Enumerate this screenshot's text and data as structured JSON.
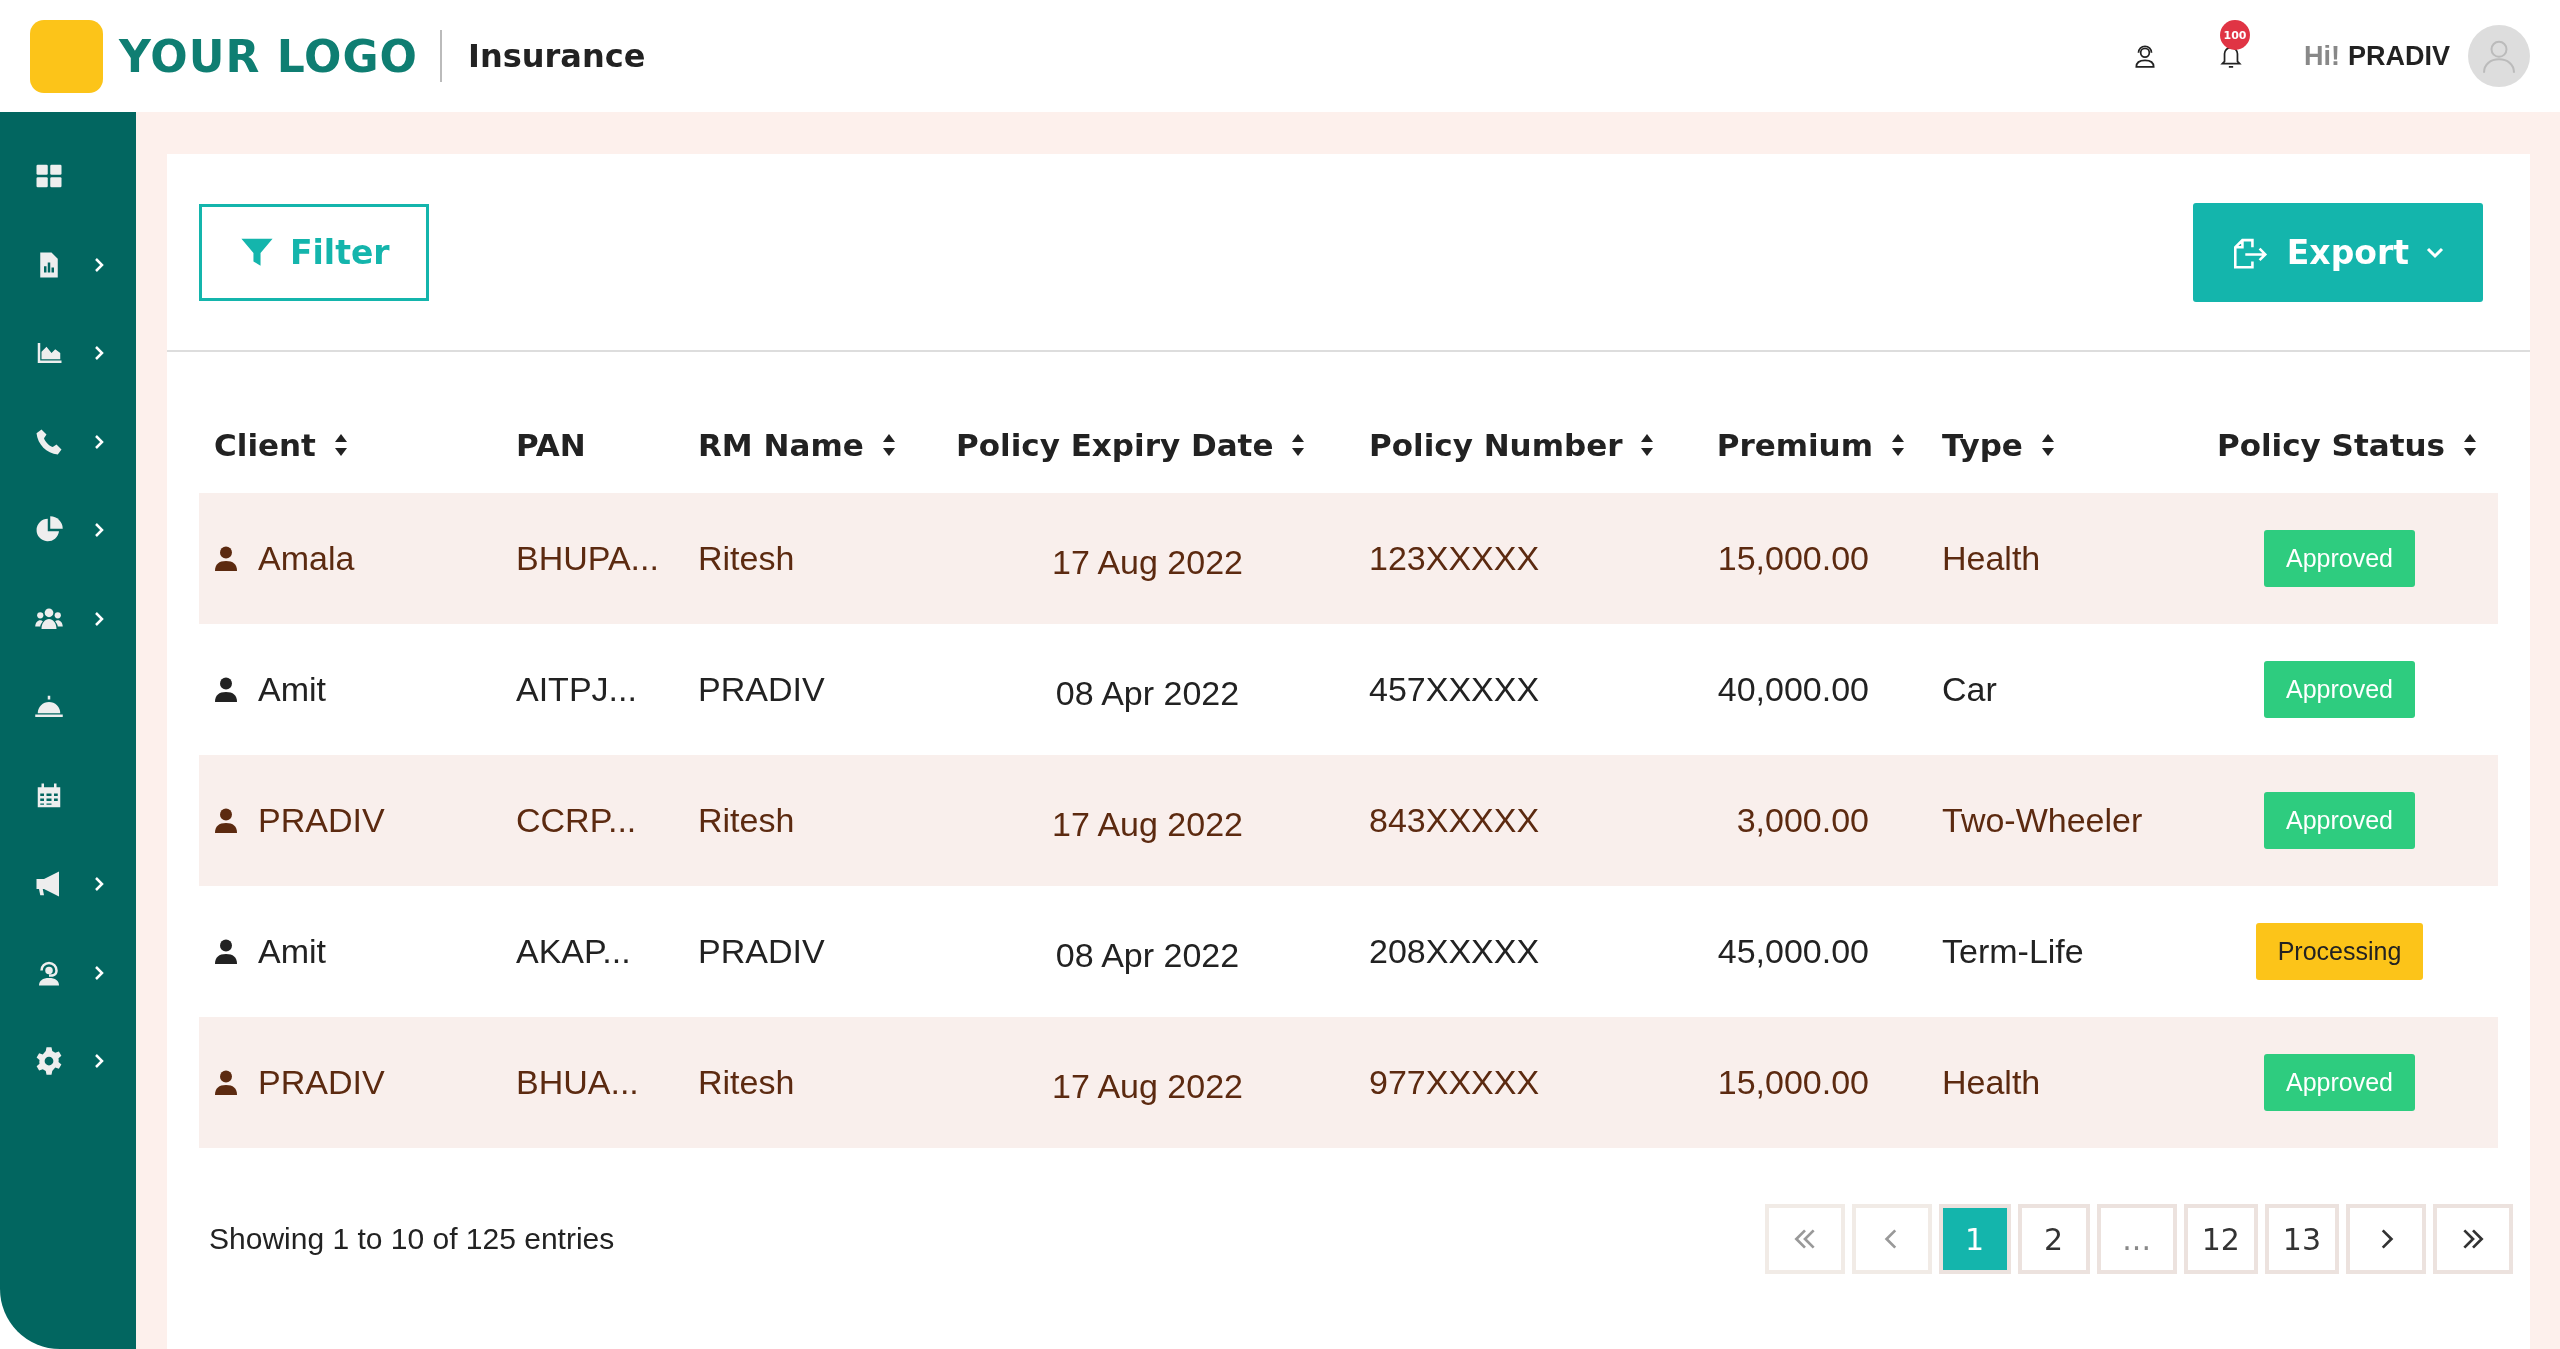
{
  "header": {
    "logo_text": "YOUR LOGO",
    "app_title": "Insurance",
    "notification_count": "100",
    "greeting": "Hi!",
    "user_name": "PRADIV"
  },
  "sidebar": {
    "items": [
      {
        "kind": "grid",
        "expandable": false
      },
      {
        "kind": "report",
        "expandable": true
      },
      {
        "kind": "area",
        "expandable": true
      },
      {
        "kind": "phone",
        "expandable": true
      },
      {
        "kind": "pie",
        "expandable": true
      },
      {
        "kind": "users",
        "expandable": true
      },
      {
        "kind": "bell",
        "expandable": false
      },
      {
        "kind": "calendar",
        "expandable": false
      },
      {
        "kind": "megaphone",
        "expandable": true
      },
      {
        "kind": "support",
        "expandable": true
      },
      {
        "kind": "gear",
        "expandable": true
      }
    ]
  },
  "toolbar": {
    "filter_label": "Filter",
    "export_label": "Export"
  },
  "table": {
    "columns": [
      {
        "label": "Client",
        "sortable": true
      },
      {
        "label": "PAN",
        "sortable": false
      },
      {
        "label": "RM Name",
        "sortable": true
      },
      {
        "label": "Policy Expiry Date",
        "sortable": true
      },
      {
        "label": "Policy Number",
        "sortable": true
      },
      {
        "label": "Premium",
        "sortable": true
      },
      {
        "label": "Type",
        "sortable": true
      },
      {
        "label": "Policy Status",
        "sortable": true
      }
    ],
    "rows": [
      {
        "client": "Amala",
        "pan": "BHUPA...",
        "rm_name": "Ritesh",
        "expiry": "17 Aug 2022",
        "policy_number": "123XXXXX",
        "premium": "15,000.00",
        "type": "Health",
        "status": "Approved",
        "color": "#2ecc7f"
      },
      {
        "client": "Amit",
        "pan": "AITPJ...",
        "rm_name": "PRADIV",
        "expiry": "08 Apr 2022",
        "policy_number": "457XXXXX",
        "premium": "40,000.00",
        "type": "Car",
        "status": "Approved",
        "color": "#2ecc7f"
      },
      {
        "client": "PRADIV",
        "pan": "CCRP...",
        "rm_name": "Ritesh",
        "expiry": "17 Aug 2022",
        "policy_number": "843XXXXX",
        "premium": "3,000.00",
        "type": "Two-Wheeler",
        "status": "Approved",
        "color": "#2ecc7f"
      },
      {
        "client": "Amit",
        "pan": "AKAP...",
        "rm_name": "PRADIV",
        "expiry": "08 Apr 2022",
        "policy_number": "208XXXXX",
        "premium": "45,000.00",
        "type": "Term-Life",
        "status": "Processing",
        "color": "#fcc419"
      },
      {
        "client": "PRADIV",
        "pan": "BHUA...",
        "rm_name": "Ritesh",
        "expiry": "17 Aug 2022",
        "policy_number": "977XXXXX",
        "premium": "15,000.00",
        "type": "Health",
        "status": "Approved",
        "color": "#2ecc7f"
      }
    ]
  },
  "footer": {
    "entries_text": "Showing 1 to 10 of 125 entries"
  },
  "pagination": [
    {
      "kind": "first",
      "disabled": true
    },
    {
      "kind": "prev",
      "disabled": true
    },
    {
      "kind": "page",
      "label": "1",
      "selected": true
    },
    {
      "kind": "page",
      "label": "2",
      "selected": false
    },
    {
      "kind": "gap",
      "label": "..."
    },
    {
      "kind": "page",
      "label": "12",
      "selected": false
    },
    {
      "kind": "page",
      "label": "13",
      "selected": false
    },
    {
      "kind": "next",
      "disabled": false
    },
    {
      "kind": "last",
      "disabled": false
    }
  ]
}
